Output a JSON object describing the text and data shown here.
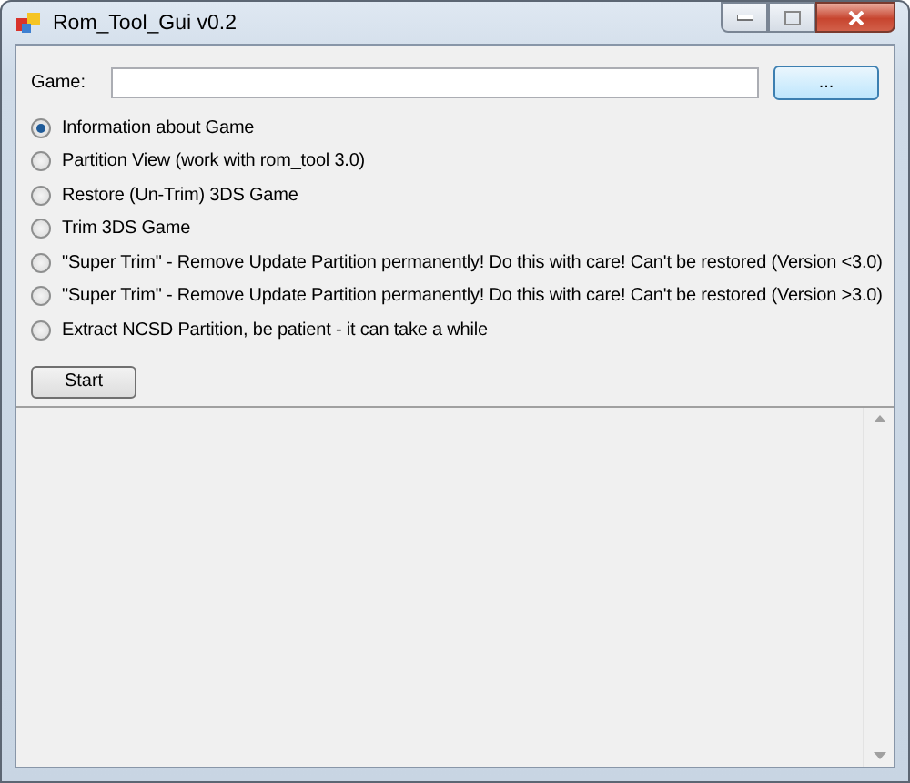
{
  "window": {
    "title": "Rom_Tool_Gui v0.2"
  },
  "game": {
    "label": "Game:",
    "browse_button": "..."
  },
  "options": [
    {
      "label": "Information about Game",
      "selected": true
    },
    {
      "label": "Partition View (work with rom_tool 3.0)",
      "selected": false
    },
    {
      "label": "Restore (Un-Trim) 3DS Game",
      "selected": false
    },
    {
      "label": "Trim 3DS Game",
      "selected": false
    },
    {
      "label": "\"Super Trim\" - Remove Update Partition permanently! Do this with care! Can't be restored (Version <3.0)",
      "selected": false
    },
    {
      "label": "\"Super Trim\" - Remove Update Partition permanently! Do this with care! Can't be restored (Version >3.0)",
      "selected": false
    },
    {
      "label": "Extract NCSD Partition, be patient - it can take a while",
      "selected": false
    }
  ],
  "start_button": "Start"
}
